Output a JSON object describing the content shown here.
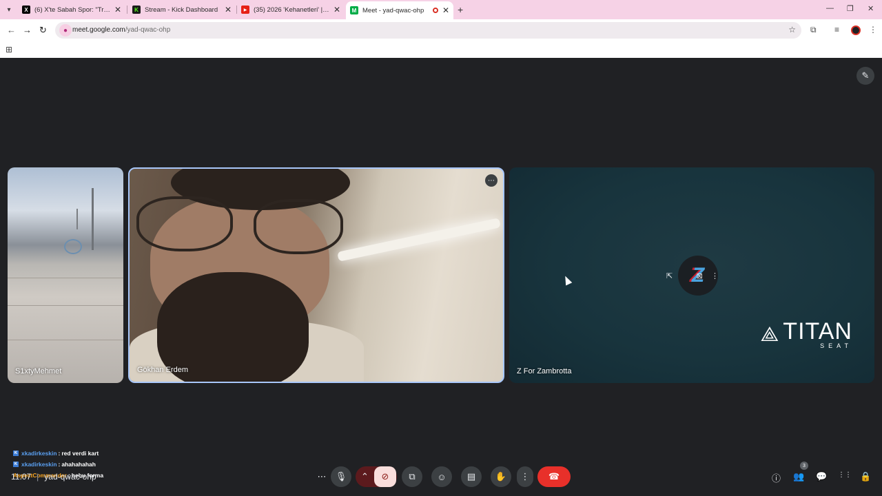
{
  "browser": {
    "tabs": [
      {
        "title": "(6) X'te Sabah Spor: \"Trabzonsp",
        "favicon": "X"
      },
      {
        "title": "Stream - Kick Dashboard",
        "favicon": "K"
      },
      {
        "title": "(35) 2026 'Kehanetleri' | Erdem A",
        "favicon": "▶"
      },
      {
        "title": "Meet - yad-qwac-ohp",
        "favicon": "M"
      }
    ],
    "new_tab": "+",
    "url_host": "meet.google.com",
    "url_path": "/yad-qwac-ohp",
    "colors": {
      "tabbar_bg": "#f6d2e6",
      "accent": "#a8c7fa",
      "hangup": "#e8302a"
    }
  },
  "participants": [
    {
      "name": "S1xtyMehmet"
    },
    {
      "name": "Gökhan Erdem"
    },
    {
      "name": "Z For Zambrotta"
    }
  ],
  "overlay_logo": {
    "word": "TITAN",
    "sub": "SEAT"
  },
  "chat": [
    {
      "user": "xkadirkeskin",
      "sep": ":",
      "msg": "red verdi kart"
    },
    {
      "user": "xkadirkeskin",
      "sep": ":",
      "msg": "ahahahahah"
    },
    {
      "user": "AspectCommander",
      "sep": ":",
      "msg": "bebu forma"
    }
  ],
  "meeting": {
    "time": "11:07",
    "pipe": "|",
    "code": "yad-qwac-ohp"
  },
  "people_count": "3",
  "icons": {
    "more": "⋯",
    "mic": "🎙",
    "chevron": "⌃",
    "camera_off": "⊘",
    "present": "⧉",
    "emoji": "☺",
    "captions": "▤",
    "raise_hand": "✋",
    "options": "⋮",
    "hangup": "☎",
    "info": "ⓘ",
    "people": "👥",
    "chat": "💬",
    "activities": "⋮⋮",
    "host": "🔒"
  }
}
